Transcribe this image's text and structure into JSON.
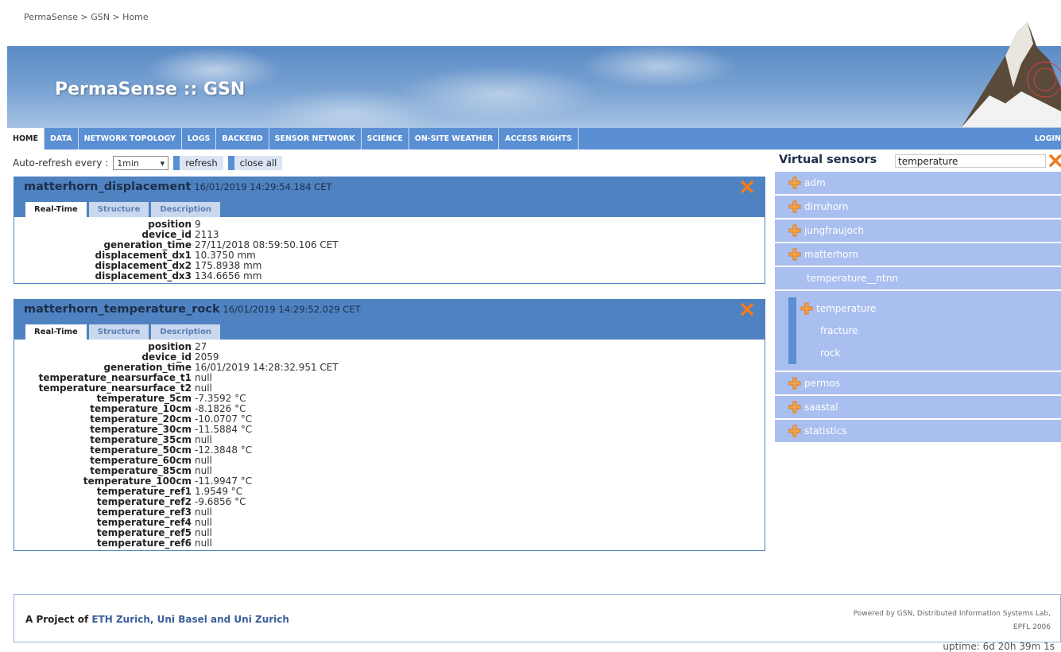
{
  "breadcrumb": "PermaSense > GSN > Home",
  "banner": {
    "title": "PermaSense :: GSN"
  },
  "nav": {
    "items": [
      "HOME",
      "DATA",
      "NETWORK TOPOLOGY",
      "LOGS",
      "BACKEND",
      "SENSOR NETWORK",
      "SCIENCE",
      "ON-SITE WEATHER",
      "ACCESS RIGHTS"
    ],
    "active": "HOME",
    "login": "LOGIN"
  },
  "toolbar": {
    "label": "Auto-refresh every :",
    "interval": "1min",
    "refresh": "refresh",
    "close_all": "close all"
  },
  "panels": [
    {
      "name": "matterhorn_displacement",
      "timestamp": "16/01/2019 14:29:54.184 CET",
      "tabs": [
        "Real-Time",
        "Structure",
        "Description"
      ],
      "fields": [
        {
          "k": "position",
          "v": "9"
        },
        {
          "k": "device_id",
          "v": "2113"
        },
        {
          "k": "generation_time",
          "v": "27/11/2018 08:59:50.106 CET"
        },
        {
          "k": "displacement_dx1",
          "v": "10.3750 mm"
        },
        {
          "k": "displacement_dx2",
          "v": "175.8938 mm"
        },
        {
          "k": "displacement_dx3",
          "v": "134.6656 mm"
        }
      ]
    },
    {
      "name": "matterhorn_temperature_rock",
      "timestamp": "16/01/2019 14:29:52.029 CET",
      "tabs": [
        "Real-Time",
        "Structure",
        "Description"
      ],
      "fields": [
        {
          "k": "position",
          "v": "27"
        },
        {
          "k": "device_id",
          "v": "2059"
        },
        {
          "k": "generation_time",
          "v": "16/01/2019 14:28:32.951 CET"
        },
        {
          "k": "temperature_nearsurface_t1",
          "v": "null"
        },
        {
          "k": "temperature_nearsurface_t2",
          "v": "null"
        },
        {
          "k": "temperature_5cm",
          "v": "-7.3592 °C"
        },
        {
          "k": "temperature_10cm",
          "v": "-8.1826 °C"
        },
        {
          "k": "temperature_20cm",
          "v": "-10.0707 °C"
        },
        {
          "k": "temperature_30cm",
          "v": "-11.5884 °C"
        },
        {
          "k": "temperature_35cm",
          "v": "null"
        },
        {
          "k": "temperature_50cm",
          "v": "-12.3848 °C"
        },
        {
          "k": "temperature_60cm",
          "v": "null"
        },
        {
          "k": "temperature_85cm",
          "v": "null"
        },
        {
          "k": "temperature_100cm",
          "v": "-11.9947 °C"
        },
        {
          "k": "temperature_ref1",
          "v": "1.9549 °C"
        },
        {
          "k": "temperature_ref2",
          "v": "-9.6856 °C"
        },
        {
          "k": "temperature_ref3",
          "v": "null"
        },
        {
          "k": "temperature_ref4",
          "v": "null"
        },
        {
          "k": "temperature_ref5",
          "v": "null"
        },
        {
          "k": "temperature_ref6",
          "v": "null"
        }
      ]
    }
  ],
  "sidebar": {
    "title": "Virtual sensors",
    "search_value": "temperature",
    "items_top": [
      "adm",
      "dirruhorn",
      "jungfraujoch",
      "matterhorn"
    ],
    "item_plain": "temperature__ntnn",
    "group": {
      "label": "temperature",
      "children": [
        "fracture",
        "rock"
      ]
    },
    "items_bottom": [
      "permos",
      "saastal",
      "statistics"
    ]
  },
  "footer": {
    "prefix": "A Project of ",
    "orgs": "ETH Zurich, Uni Basel and Uni Zurich",
    "powered": "Powered by GSN, Distributed Information Systems Lab, EPFL 2006"
  },
  "uptime": "uptime: 6d 20h 39m 1s",
  "colors": {
    "nav": "#5a8fd4",
    "panel_head": "#4f82c1",
    "sidebar_item": "#a9bff0",
    "close_icon": "#f07c1e"
  }
}
